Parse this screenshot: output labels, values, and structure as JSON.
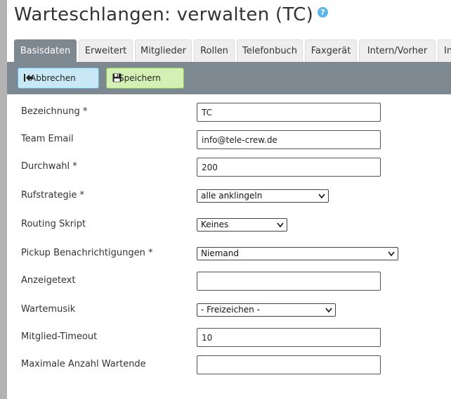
{
  "page": {
    "title": "Warteschlangen: verwalten (TC)",
    "help_icon": "question-circle-icon"
  },
  "tabs": [
    {
      "label": "Basisdaten",
      "active": true
    },
    {
      "label": "Erweitert"
    },
    {
      "label": "Mitglieder"
    },
    {
      "label": "Rollen"
    },
    {
      "label": "Telefonbuch"
    },
    {
      "label": "Faxgerät"
    },
    {
      "label": "Intern/Vorher"
    },
    {
      "label": "In"
    }
  ],
  "toolbar": {
    "cancel_label": "Abbrechen",
    "cancel_icon": "back-to-start-icon",
    "save_label": "Speichern",
    "save_icon": "floppy-disk-icon"
  },
  "form": {
    "bezeichnung": {
      "label": "Bezeichnung *",
      "value": "TC"
    },
    "team_email": {
      "label": "Team Email",
      "value": "info@tele-crew.de"
    },
    "durchwahl": {
      "label": "Durchwahl *",
      "value": "200"
    },
    "rufstrategie": {
      "label": "Rufstrategie *",
      "selected": "alle anklingeln"
    },
    "routing_skript": {
      "label": "Routing Skript",
      "selected": "Keines"
    },
    "pickup": {
      "label": "Pickup Benachrichtigungen *",
      "selected": "Niemand"
    },
    "anzeigetext": {
      "label": "Anzeigetext",
      "value": ""
    },
    "wartemusik": {
      "label": "Wartemusik",
      "selected": "- Freizeichen -"
    },
    "mitglied_timeout": {
      "label": "Mitglied-Timeout",
      "value": "10"
    },
    "max_wartende": {
      "label": "Maximale Anzahl Wartende",
      "value": ""
    }
  },
  "colors": {
    "toolbar_bg": "#7e8891",
    "cancel_bg": "#c8e8f6",
    "save_bg": "#d4f0b4",
    "help_icon": "#5bb8ec"
  }
}
